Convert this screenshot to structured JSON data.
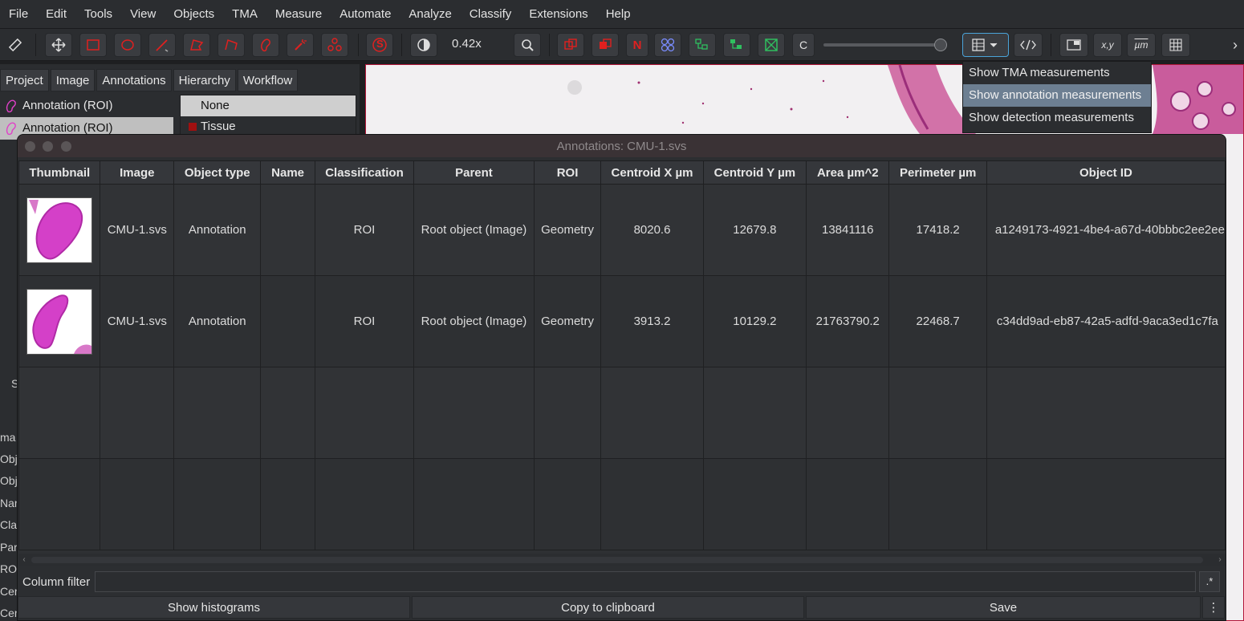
{
  "menubar": {
    "items": [
      "File",
      "Edit",
      "Tools",
      "View",
      "Objects",
      "TMA",
      "Measure",
      "Automate",
      "Analyze",
      "Classify",
      "Extensions",
      "Help"
    ]
  },
  "toolbar": {
    "zoom": "0.42x",
    "c_label": "C",
    "n_label": "N",
    "s_label": "S",
    "xy_label": "x,y",
    "um_label": "µm",
    "icons": [
      "measure-icon",
      "move-icon",
      "rectangle-icon",
      "ellipse-icon",
      "line-icon",
      "polygon-icon",
      "polyline-icon",
      "brush-icon",
      "wand-icon",
      "points-icon",
      "s-tool-icon",
      "contrast-icon",
      "zoom-fit-icon",
      "show-annotations-icon",
      "fill-annotations-icon",
      "show-names-icon",
      "tma-grid-icon",
      "show-detections-icon",
      "fill-detections-icon",
      "pixel-classification-icon",
      "measurement-table-icon",
      "script-editor-icon",
      "overview-icon",
      "location-icon",
      "scalebar-icon",
      "grid-icon"
    ],
    "accent": "#e0201f",
    "opacity_level": 0.97
  },
  "left_panel": {
    "tabs": [
      "Project",
      "Image",
      "Annotations",
      "Hierarchy",
      "Workflow"
    ],
    "annotations": [
      "Annotation (ROI)",
      "Annotation (ROI)"
    ],
    "classes": [
      "None",
      "Tissue"
    ],
    "stub_labels": [
      "S",
      "ma",
      "Obj",
      "Obj",
      "Nar",
      "Cla",
      "Par",
      "RO",
      "Cer",
      "Cer"
    ]
  },
  "dropdown": {
    "items": [
      "Show TMA measurements",
      "Show annotation measurements",
      "Show detection measurements"
    ],
    "highlighted": 1
  },
  "window": {
    "title": "Annotations: CMU-1.svs",
    "columns": [
      "Thumbnail",
      "Image",
      "Object type",
      "Name",
      "Classification",
      "Parent",
      "ROI",
      "Centroid X µm",
      "Centroid Y µm",
      "Area µm^2",
      "Perimeter µm",
      "Object ID"
    ],
    "rows": [
      {
        "image": "CMU-1.svs",
        "object_type": "Annotation",
        "name": "",
        "classification": "ROI",
        "parent": "Root object (Image)",
        "roi": "Geometry",
        "centroid_x": "8020.6",
        "centroid_y": "12679.8",
        "area": "13841116",
        "perimeter": "17418.2",
        "object_id": "a1249173-4921-4be4-a67d-40bbbc2ee2ee"
      },
      {
        "image": "CMU-1.svs",
        "object_type": "Annotation",
        "name": "",
        "classification": "ROI",
        "parent": "Root object (Image)",
        "roi": "Geometry",
        "centroid_x": "3913.2",
        "centroid_y": "10129.2",
        "area": "21763790.2",
        "perimeter": "22468.7",
        "object_id": "c34dd9ad-eb87-42a5-adfd-9aca3ed1c7fa"
      }
    ],
    "filter_label": "Column filter",
    "filter_value": "",
    "regex_label": ".*",
    "buttons": [
      "Show histograms",
      "Copy to clipboard",
      "Save"
    ],
    "more_label": "⋮"
  }
}
